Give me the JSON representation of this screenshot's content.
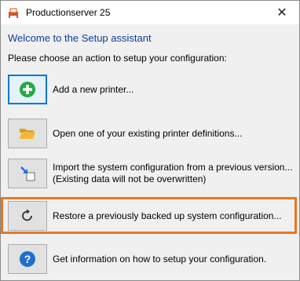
{
  "window": {
    "title": "Productionserver 25",
    "close_glyph": "✕"
  },
  "welcome": "Welcome to the Setup assistant",
  "instruction": "Please choose an action to setup your configuration:",
  "actions": [
    {
      "icon": "add-icon",
      "line1": "Add a new printer...",
      "line2": ""
    },
    {
      "icon": "folder-open-icon",
      "line1": "Open one of your existing printer definitions...",
      "line2": ""
    },
    {
      "icon": "import-icon",
      "line1": "Import the system configuration from a previous version...",
      "line2": "(Existing data will not be overwritten)"
    },
    {
      "icon": "restore-icon",
      "line1": "Restore a previously backed up system configuration...",
      "line2": ""
    },
    {
      "icon": "help-icon",
      "line1": "Get information on how to setup your configuration.",
      "line2": ""
    }
  ],
  "colors": {
    "accent_blue": "#0b3f9a",
    "highlight_orange": "#e8781e",
    "focus_blue": "#0078d7",
    "add_green": "#27a844",
    "help_blue": "#1f6fd1",
    "folder_yellow": "#f0b73a"
  }
}
